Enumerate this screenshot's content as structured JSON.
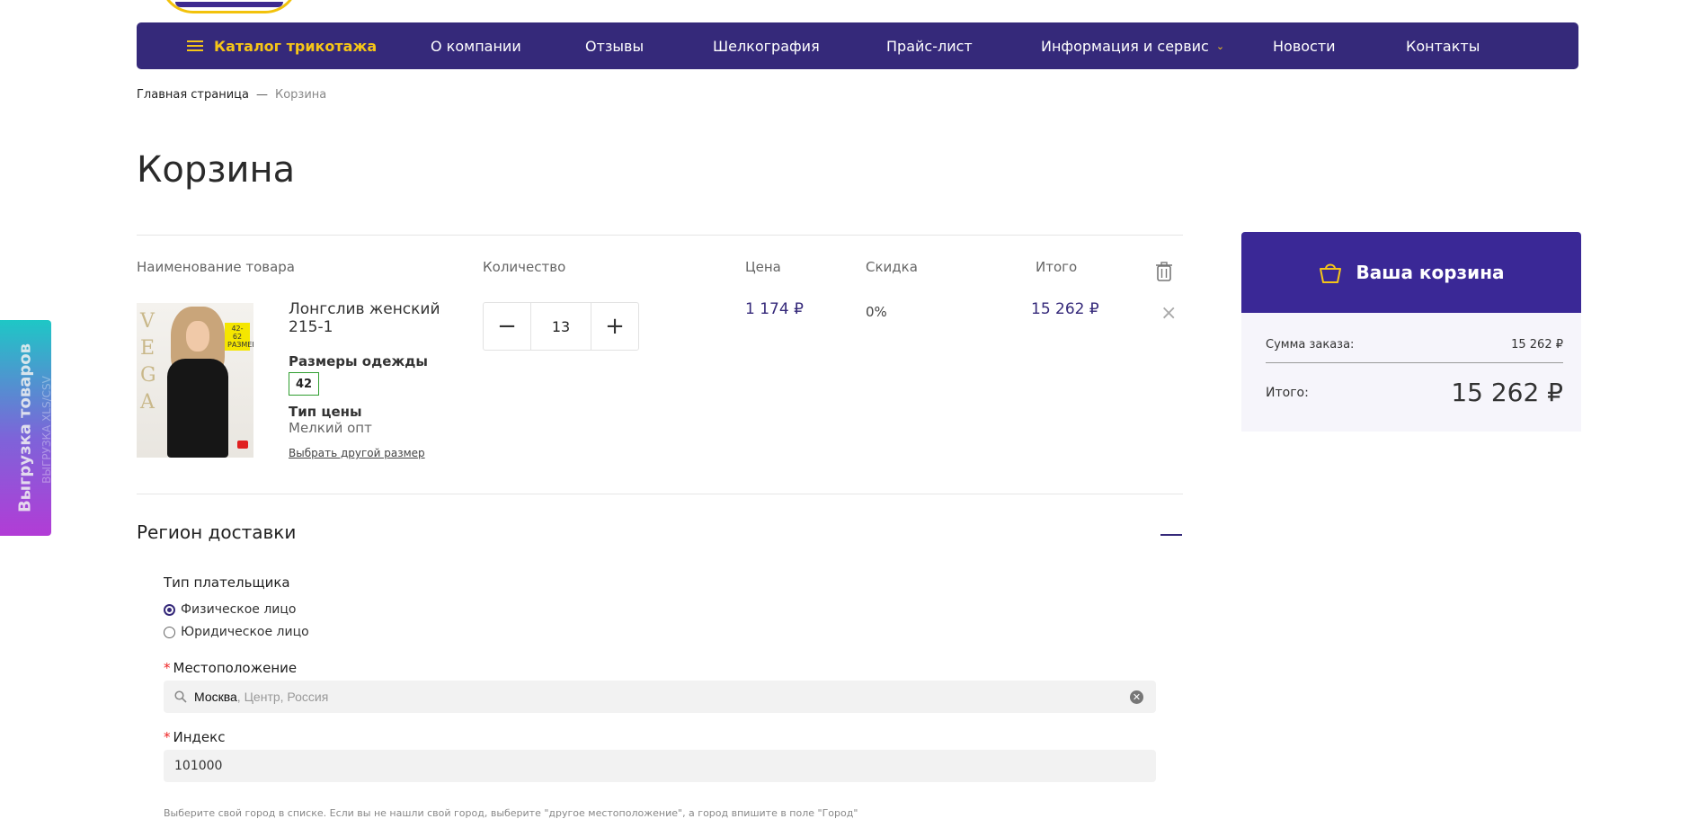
{
  "nav": {
    "catalog": "Каталог трикотажа",
    "items": [
      "О компании",
      "Отзывы",
      "Шелкография",
      "Прайс-лист",
      "Информация и сервис",
      "Новости",
      "Контакты"
    ]
  },
  "breadcrumb": {
    "home": "Главная страница",
    "separator": "—",
    "current": "Корзина"
  },
  "page_title": "Корзина",
  "table": {
    "headers": {
      "name": "Наименование товара",
      "qty": "Количество",
      "price": "Цена",
      "discount": "Скидка",
      "total": "Итого"
    }
  },
  "item": {
    "image_text": {
      "brand_letters": "V E G A",
      "badge": "42-62 РАЗМЕРЫ"
    },
    "name": "Лонгслив женский 215-1",
    "sizes_label": "Размеры одежды",
    "size": "42",
    "price_type_label": "Тип цены",
    "price_type": "Мелкий опт",
    "other_size_link": "Выбрать другой размер",
    "qty_minus": "−",
    "quantity": "13",
    "qty_plus": "+",
    "price": "1 174 ₽",
    "discount": "0%",
    "total": "15 262 ₽",
    "remove": "×"
  },
  "delivery": {
    "title": "Регион доставки",
    "payer_type_label": "Тип плательщика",
    "payer_options": [
      "Физическое лицо",
      "Юридическое лицо"
    ],
    "payer_selected_index": 0,
    "location_label": "Местоположение",
    "location_city": "Москва",
    "location_rest": ", Центр, Россия",
    "index_label": "Индекс",
    "index_value": "101000",
    "hint": "Выберите свой город в списке. Если вы не нашли свой город, выберите \"другое местоположение\", а город впишите в поле \"Город\""
  },
  "cart_summary": {
    "title": "Ваша корзина",
    "order_sum_label": "Сумма заказа:",
    "order_sum_value": "15 262 ₽",
    "total_label": "Итого:",
    "total_value": "15 262 ₽"
  },
  "side_tab": {
    "label": "Выгрузка товаров",
    "sublabel": "ВЫГРУЗКА XLS/CSV"
  },
  "colors": {
    "primary": "#35297a",
    "cart_header": "#3a2896",
    "accent": "#f5c518"
  },
  "icons": [
    "menu-icon",
    "chevron-down-icon",
    "trash-icon",
    "close-icon",
    "basket-icon",
    "search-icon",
    "clear-icon"
  ]
}
